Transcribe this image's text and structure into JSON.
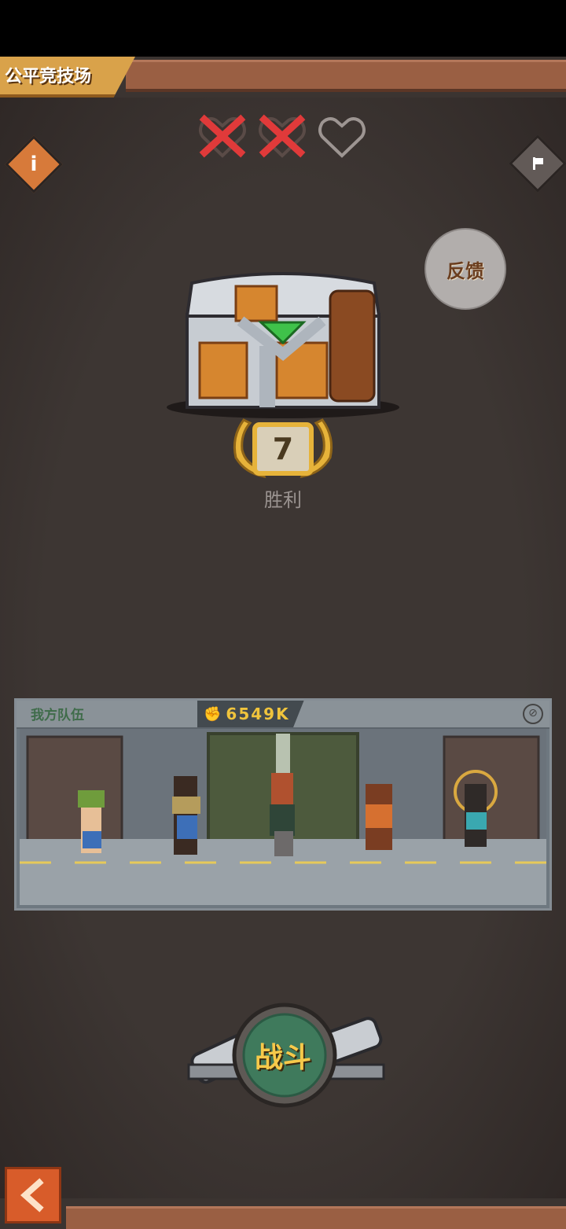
{
  "header": {
    "title": "公平竞技场"
  },
  "attempts": {
    "lost": 2,
    "remaining": 1,
    "total": 3
  },
  "buttons": {
    "feedback": "反馈",
    "battle": "战斗"
  },
  "chest": {
    "wins": "7",
    "wins_label": "胜利"
  },
  "team": {
    "label": "我方队伍",
    "power": "6549K"
  },
  "colors": {
    "accent": "#d9a24a",
    "brand_brown": "#9a5f43",
    "battle_green": "#3f7a5c",
    "loss_red": "#e03a3a",
    "back_orange": "#d85c2a"
  }
}
